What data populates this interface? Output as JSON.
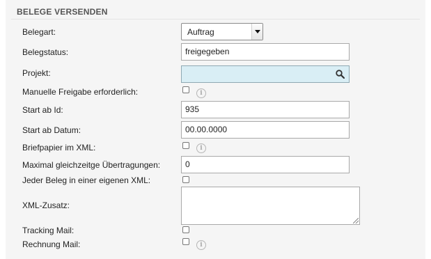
{
  "section": {
    "title": "BELEGE VERSENDEN"
  },
  "fields": {
    "belegart": {
      "label": "Belegart:",
      "value": "Auftrag"
    },
    "belegstatus": {
      "label": "Belegstatus:",
      "value": "freigegeben"
    },
    "projekt": {
      "label": "Projekt:",
      "value": ""
    },
    "manuelle_freigabe": {
      "label": "Manuelle Freigabe erforderlich:",
      "checked": false
    },
    "start_ab_id": {
      "label": "Start ab Id:",
      "value": "935"
    },
    "start_ab_datum": {
      "label": "Start ab Datum:",
      "value": "00.00.0000"
    },
    "briefpapier": {
      "label": "Briefpapier im XML:",
      "checked": false
    },
    "maximal_uebertragungen": {
      "label": "Maximal gleichzeitge Übertragungen:",
      "value": "0"
    },
    "jeder_beleg": {
      "label": "Jeder Beleg in einer eigenen XML:",
      "checked": false
    },
    "xml_zusatz": {
      "label": "XML-Zusatz:",
      "value": ""
    },
    "tracking_mail": {
      "label": "Tracking Mail:",
      "checked": false
    },
    "rechnung_mail": {
      "label": "Rechnung Mail:",
      "checked": false
    }
  },
  "icons": {
    "info": "i"
  },
  "colors": {
    "panel_background": "#f5f5f5",
    "project_field_background": "#d9eef5",
    "info_icon": "#a8a8a8"
  }
}
